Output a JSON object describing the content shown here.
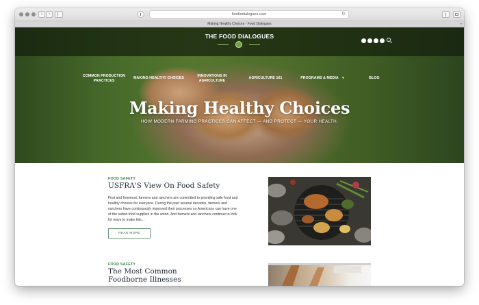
{
  "browser": {
    "url": "foodiedialogues.com",
    "tab_title": "Making Healthy Choices - Food Dialogues",
    "back_glyph": "‹",
    "forward_glyph": "›",
    "reload_glyph": "↻",
    "new_tab_glyph": "+",
    "icons": [
      "back-icon",
      "forward-icon",
      "sidebar-icon",
      "shield-icon",
      "reload-icon",
      "share-icon",
      "tabs-icon"
    ]
  },
  "site": {
    "brand": "THE FOOD DIALOGUES",
    "social_icons": [
      "facebook-icon",
      "twitter-icon",
      "pinterest-icon",
      "youtube-icon"
    ]
  },
  "nav": {
    "items": [
      {
        "label": "COMMON PRODUCTION\nPRACTICES"
      },
      {
        "label": "MAKING HEALTHY CHOICES"
      },
      {
        "label": "INNOVATIONS IN\nAGRICULTURE"
      },
      {
        "label": "AGRICULTURE 101"
      },
      {
        "label": "PROGRAMS & MEDIA"
      },
      {
        "label": "BLOG"
      }
    ],
    "caret": "▾"
  },
  "hero": {
    "title": "Making Healthy Choices",
    "subtitle": "HOW MODERN FARMING PRACTICES CAN AFFECT — AND PROTECT — YOUR HEALTH."
  },
  "articles": [
    {
      "category": "FOOD SAFETY",
      "title": "USFRA'S View On Food Safety",
      "excerpt": "First and foremost, farmers and ranchers are committed to providing safe food and healthy choices for everyone. During the past several decades, farmers and ranchers have continuously improved their processes so Americans can have one of the safest food supplies in the world. And farmers and ranchers continue to look for ways to make this...",
      "read_more": "READ MORE"
    },
    {
      "category": "FOOD SAFETY",
      "title": "The Most Common Foodborne Illnesses"
    }
  ],
  "colors": {
    "accent_green": "#2f7a3d",
    "title_navy": "#1f2a36"
  }
}
